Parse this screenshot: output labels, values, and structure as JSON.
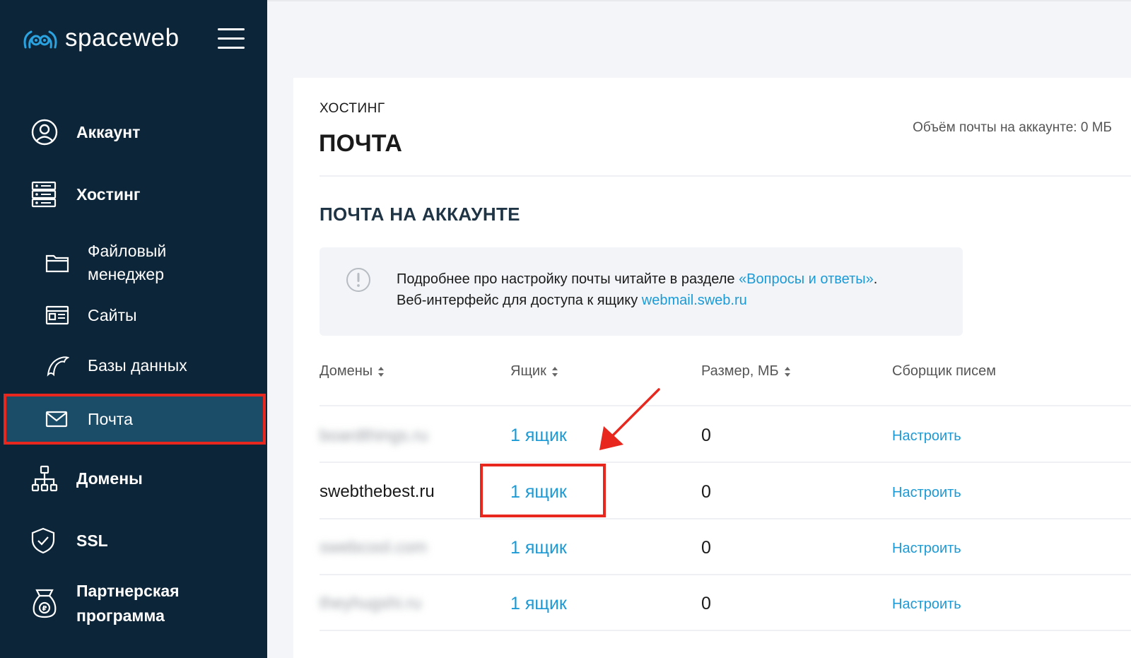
{
  "app": {
    "logo_text": "spaceweb"
  },
  "sidebar": {
    "items": [
      {
        "label": "Аккаунт",
        "icon": "user-circle-icon"
      },
      {
        "label": "Хостинг",
        "icon": "server-icon"
      },
      {
        "label": "Файловый\nменеджер",
        "icon": "folder-icon"
      },
      {
        "label": "Сайты",
        "icon": "browser-window-icon"
      },
      {
        "label": "Базы данных",
        "icon": "dolphin-icon"
      },
      {
        "label": "Почта",
        "icon": "envelope-icon",
        "active": true
      },
      {
        "label": "Домены",
        "icon": "sitemap-icon"
      },
      {
        "label": "SSL",
        "icon": "shield-check-icon"
      },
      {
        "label": "Партнерская\nпрограмма",
        "icon": "money-bag-icon"
      }
    ]
  },
  "header": {
    "breadcrumb": "ХОСТИНГ",
    "title": "ПОЧТА",
    "quota": "Объём почты на аккаунте: 0 МБ"
  },
  "section": {
    "title": "ПОЧТА НА АККАУНТЕ"
  },
  "info": {
    "line1_prefix": "Подробнее про настройку почты читайте в разделе ",
    "faq_link": "«Вопросы и ответы»",
    "line1_suffix": ".",
    "line2_prefix": "Веб-интерфейс для доступа к ящику ",
    "webmail_link": "webmail.sweb.ru"
  },
  "table": {
    "headers": [
      "Домены",
      "Ящик",
      "Размер, МБ",
      "Сборщик писем"
    ],
    "rows": [
      {
        "domain": "boardthings.ru",
        "blurred": true,
        "boxes": "1 ящик",
        "size": "0",
        "collector": "Настроить"
      },
      {
        "domain": "swebthebest.ru",
        "blurred": false,
        "boxes": "1 ящик",
        "size": "0",
        "collector": "Настроить"
      },
      {
        "domain": "swebcool.com",
        "blurred": true,
        "boxes": "1 ящик",
        "size": "0",
        "collector": "Настроить"
      },
      {
        "domain": "theyhugshi.ru",
        "blurred": true,
        "boxes": "1 ящик",
        "size": "0",
        "collector": "Настроить"
      }
    ]
  },
  "colors": {
    "sidebar_bg": "#0d2538",
    "active_item_bg": "#1b4c68",
    "accent_link": "#1c9ad6",
    "annotation_red": "#e8281e"
  }
}
